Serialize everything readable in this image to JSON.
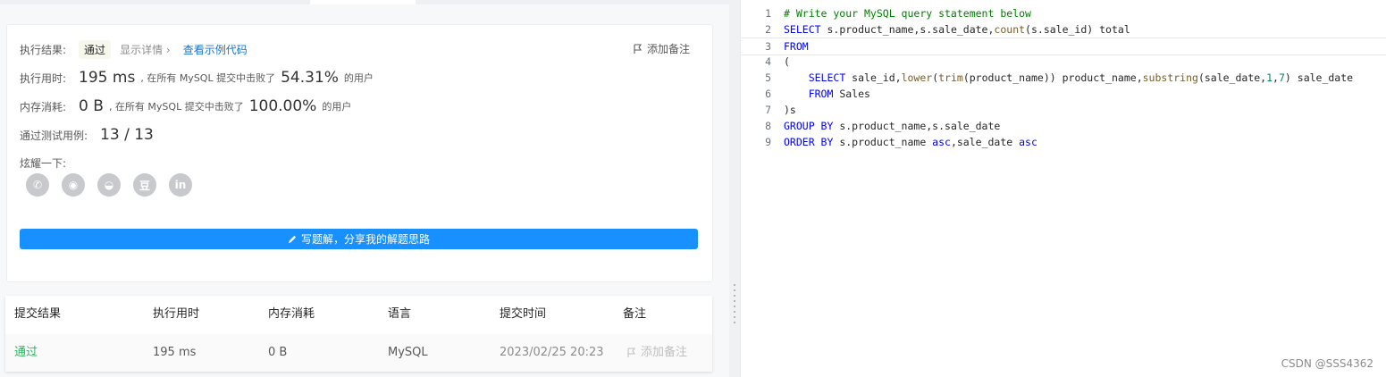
{
  "result_card": {
    "exec_result_label": "执行结果:",
    "status": "通过",
    "show_details": "显示详情 ›",
    "view_sample_code": "查看示例代码",
    "add_note": "添加备注",
    "runtime_label": "执行用时:",
    "runtime_value": "195 ms",
    "runtime_beat_text": ", 在所有 MySQL 提交中击败了",
    "runtime_percent": "54.31%",
    "users_suffix": "的用户",
    "memory_label": "内存消耗:",
    "memory_value": "0 B",
    "memory_beat_text": ", 在所有 MySQL 提交中击败了",
    "memory_percent": "100.00%",
    "memory_users_suffix": "的用户",
    "testcases_label": "通过测试用例:",
    "testcases_value": "13 / 13",
    "share_label": "炫耀一下:",
    "share_icons": [
      "wechat-icon",
      "weibo-icon",
      "qq-icon",
      "douban-icon",
      "linkedin-icon"
    ],
    "share_glyphs": [
      "✆",
      "◉",
      "◒",
      "豆",
      "in"
    ],
    "write_solution": "写题解，分享我的解题思路"
  },
  "submissions": {
    "headers": [
      "提交结果",
      "执行用时",
      "内存消耗",
      "语言",
      "提交时间",
      "备注"
    ],
    "row": {
      "result": "通过",
      "runtime": "195 ms",
      "memory": "0 B",
      "language": "MySQL",
      "time": "2023/02/25 20:23",
      "note": "添加备注"
    }
  },
  "editor": {
    "line_numbers": [
      "1",
      "2",
      "3",
      "4",
      "5",
      "6",
      "7",
      "8",
      "9"
    ]
  },
  "watermark": "CSDN @SSS4362",
  "colors": {
    "accent": "#1890ff",
    "pass_green": "#2db55d"
  }
}
